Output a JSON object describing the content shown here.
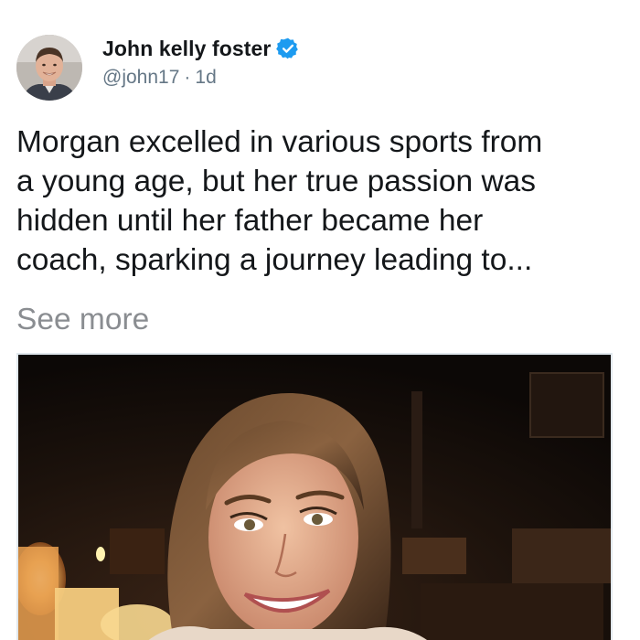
{
  "post": {
    "author": {
      "display_name": "John kelly foster",
      "handle": "@john17",
      "separator": "·",
      "time_ago": "1d",
      "verified": true,
      "verified_icon": "verified-badge-icon",
      "verified_color": "#1d9bf0"
    },
    "text": "Morgan excelled in various sports from\na young age, but her true passion was\nhidden until her father became her\ncoach, sparking a journey leading to...",
    "see_more_label": "See more",
    "colors": {
      "text": "#14171a",
      "secondary": "#657786",
      "see_more": "#8a8d91"
    }
  }
}
